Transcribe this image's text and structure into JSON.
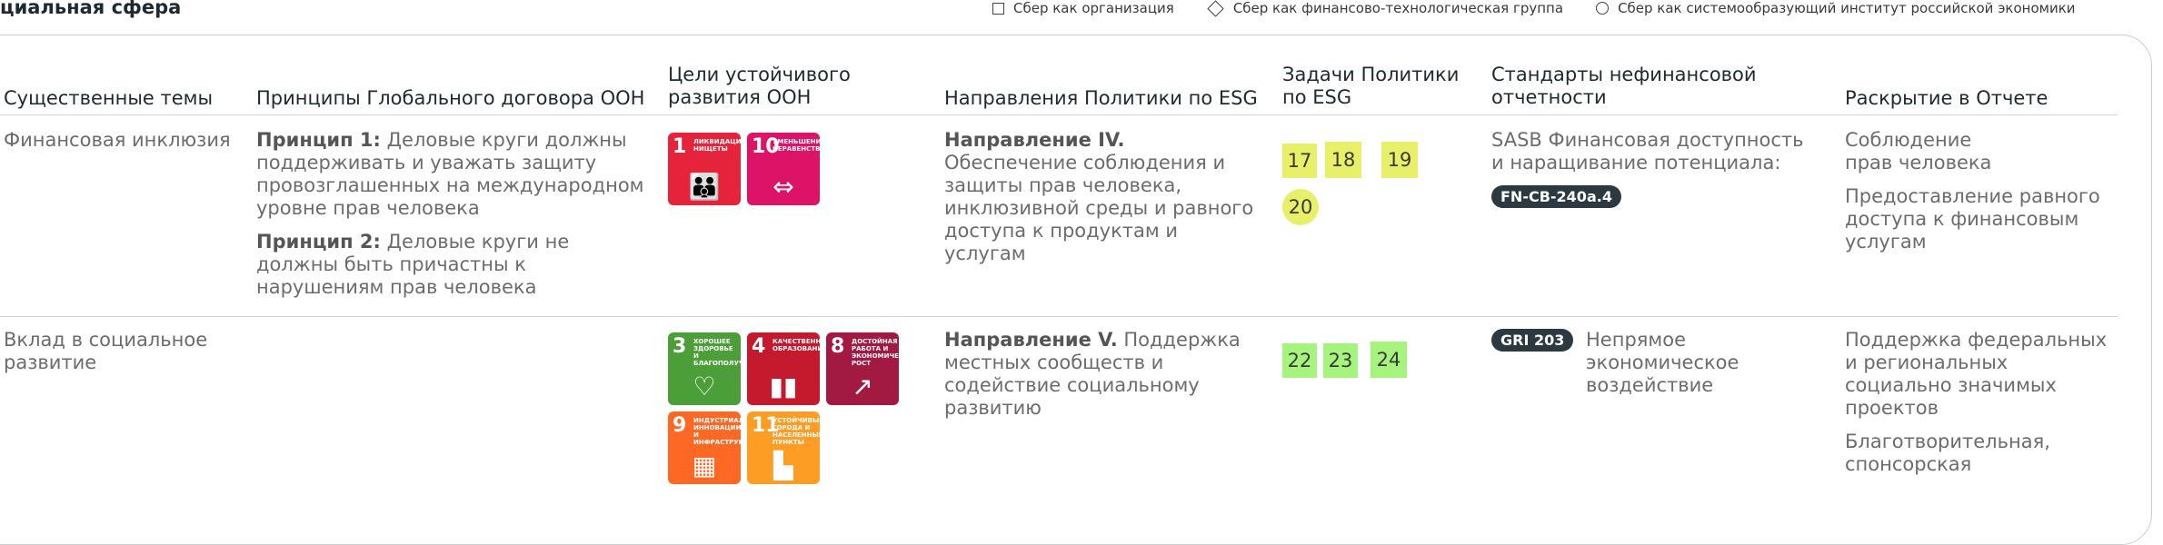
{
  "section_title": "циальная сфера",
  "legend": {
    "org": "Сбер как организация",
    "group": "Сбер как финансово-технологическая группа",
    "institute": "Сбер как системообразующий институт российской экономики"
  },
  "headers": {
    "topics": "Существенные темы",
    "principles": "Принципы Глобального договора ООН",
    "sdg_1": "Цели устойчивого",
    "sdg_2": "развития ООН",
    "directions": "Направления Политики по ESG",
    "tasks_1": "Задачи Политики",
    "tasks_2": "по ESG",
    "standards_1": "Стандарты нефинансовой",
    "standards_2": "отчетности",
    "disclosure": "Раскрытие в Отчете"
  },
  "rows": [
    {
      "topic": "Финансовая инклюзия",
      "principle1_title": "Принцип 1:",
      "principle1_text": "Деловые круги должны поддерживать и уважать защиту провозглашенных на международном уровне прав человека",
      "principle2_title": "Принцип 2:",
      "principle2_text": "Деловые круги не должны быть причастны к нарушениям прав человека",
      "sdg": [
        {
          "num": "1",
          "label": "Ликвидация нищеты",
          "color": "#e5243b",
          "icon": "family-icon"
        },
        {
          "num": "10",
          "label": "Уменьшение неравенства",
          "color": "#dd1367",
          "icon": "equality-icon"
        }
      ],
      "direction_title": "Направление IV.",
      "direction_text": "Обеспечение соблюдения и защиты прав человека, инклюзивной среды и равного доступа к продуктам и услугам",
      "tasks": [
        "17",
        "18",
        "19",
        "20"
      ],
      "standard_text": "SASB Финансовая доступность и наращивание потенциала:",
      "standard_code": "FN-CB-240a.4",
      "disclosure": [
        "Соблюдение прав человека",
        "Предоставление равного доступа к финансовым услугам"
      ]
    },
    {
      "topic": "Вклад в социальное развитие",
      "sdg": [
        {
          "num": "3",
          "label": "Хорошее здоровье и благополучие",
          "color": "#4c9f38",
          "icon": "heartbeat-icon"
        },
        {
          "num": "4",
          "label": "Качественное образование",
          "color": "#c5192d",
          "icon": "book-icon"
        },
        {
          "num": "8",
          "label": "Достойная работа и экономический рост",
          "color": "#a21942",
          "icon": "growth-icon"
        },
        {
          "num": "9",
          "label": "Индустриализация, инновации и инфраструктура",
          "color": "#fd6925",
          "icon": "cubes-icon"
        },
        {
          "num": "11",
          "label": "Устойчивые города и населенные пункты",
          "color": "#fd9d24",
          "icon": "city-icon"
        }
      ],
      "direction_title": "Направление V.",
      "direction_text": "Поддержка местных сообществ и содействие социальному развитию",
      "tasks": [
        "22",
        "23",
        "24"
      ],
      "standard_code": "GRI 203",
      "standard_text": "Непрямое экономическое воздействие",
      "disclosure": [
        "Поддержка федеральных и региональных социально значимых проектов",
        "Благотворительная, спонсорская"
      ]
    }
  ],
  "colors": {
    "task_yellow": "#e8f06a",
    "task_green": "#a6f47e",
    "pill": "#2b3a42"
  }
}
